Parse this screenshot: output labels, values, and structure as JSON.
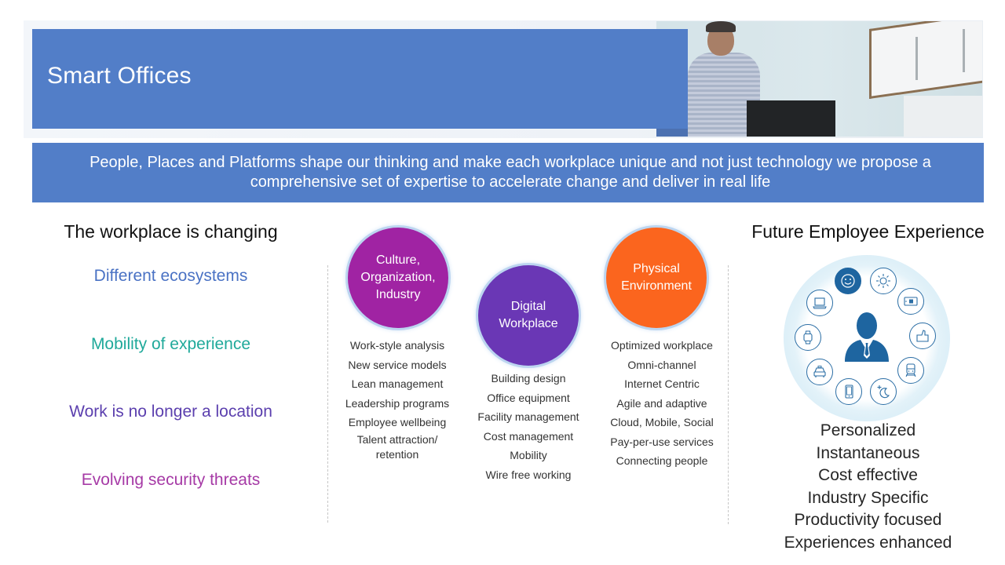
{
  "header": {
    "title": "Smart Offices",
    "photo_alt": "office-worker-photo"
  },
  "subtitle": {
    "text": "People, Places and Platforms shape our thinking and make each workplace unique and not just technology we propose a comprehensive set of expertise to accelerate change and deliver in real life"
  },
  "left": {
    "heading": "The workplace is changing",
    "items": [
      {
        "label": "Different ecosystems",
        "color": "#4a72c4"
      },
      {
        "label": "Mobility of experience",
        "color": "#1fa99a"
      },
      {
        "label": "Work is no longer a location",
        "color": "#5b3fae"
      },
      {
        "label": "Evolving security threats",
        "color": "#a63aa6"
      }
    ]
  },
  "pillars": [
    {
      "title": "Culture, Organization, Industry",
      "color": "#a023a3",
      "bullets": [
        "Work-style analysis",
        "New service models",
        "Lean management",
        "Leadership programs",
        "Employee wellbeing",
        "Talent attraction/ retention"
      ]
    },
    {
      "title": "Digital Workplace",
      "color": "#6a37b5",
      "bullets": [
        "Building design",
        "Office equipment",
        "Facility management",
        "Cost management",
        "Mobility",
        "Wire free working"
      ]
    },
    {
      "title": "Physical Environment",
      "color": "#fb651e",
      "bullets": [
        "Optimized workplace",
        "Omni-channel",
        "Internet Centric",
        "Agile and adaptive",
        "Cloud, Mobile, Social",
        "Pay-per-use services",
        "Connecting people"
      ]
    }
  ],
  "right": {
    "heading": "Future Employee Experience",
    "icons": [
      "smiley-icon",
      "sun-icon",
      "tablet-icon",
      "thumbs-up-icon",
      "train-icon",
      "moon-icon",
      "smartphone-icon",
      "taxi-icon",
      "smartwatch-icon",
      "laptop-icon"
    ],
    "center_icon": "employee-icon",
    "accent_color": "#1e65a0",
    "items": [
      "Personalized",
      "Instantaneous",
      "Cost effective",
      "Industry Specific",
      "Productivity focused",
      "Experiences enhanced"
    ]
  }
}
